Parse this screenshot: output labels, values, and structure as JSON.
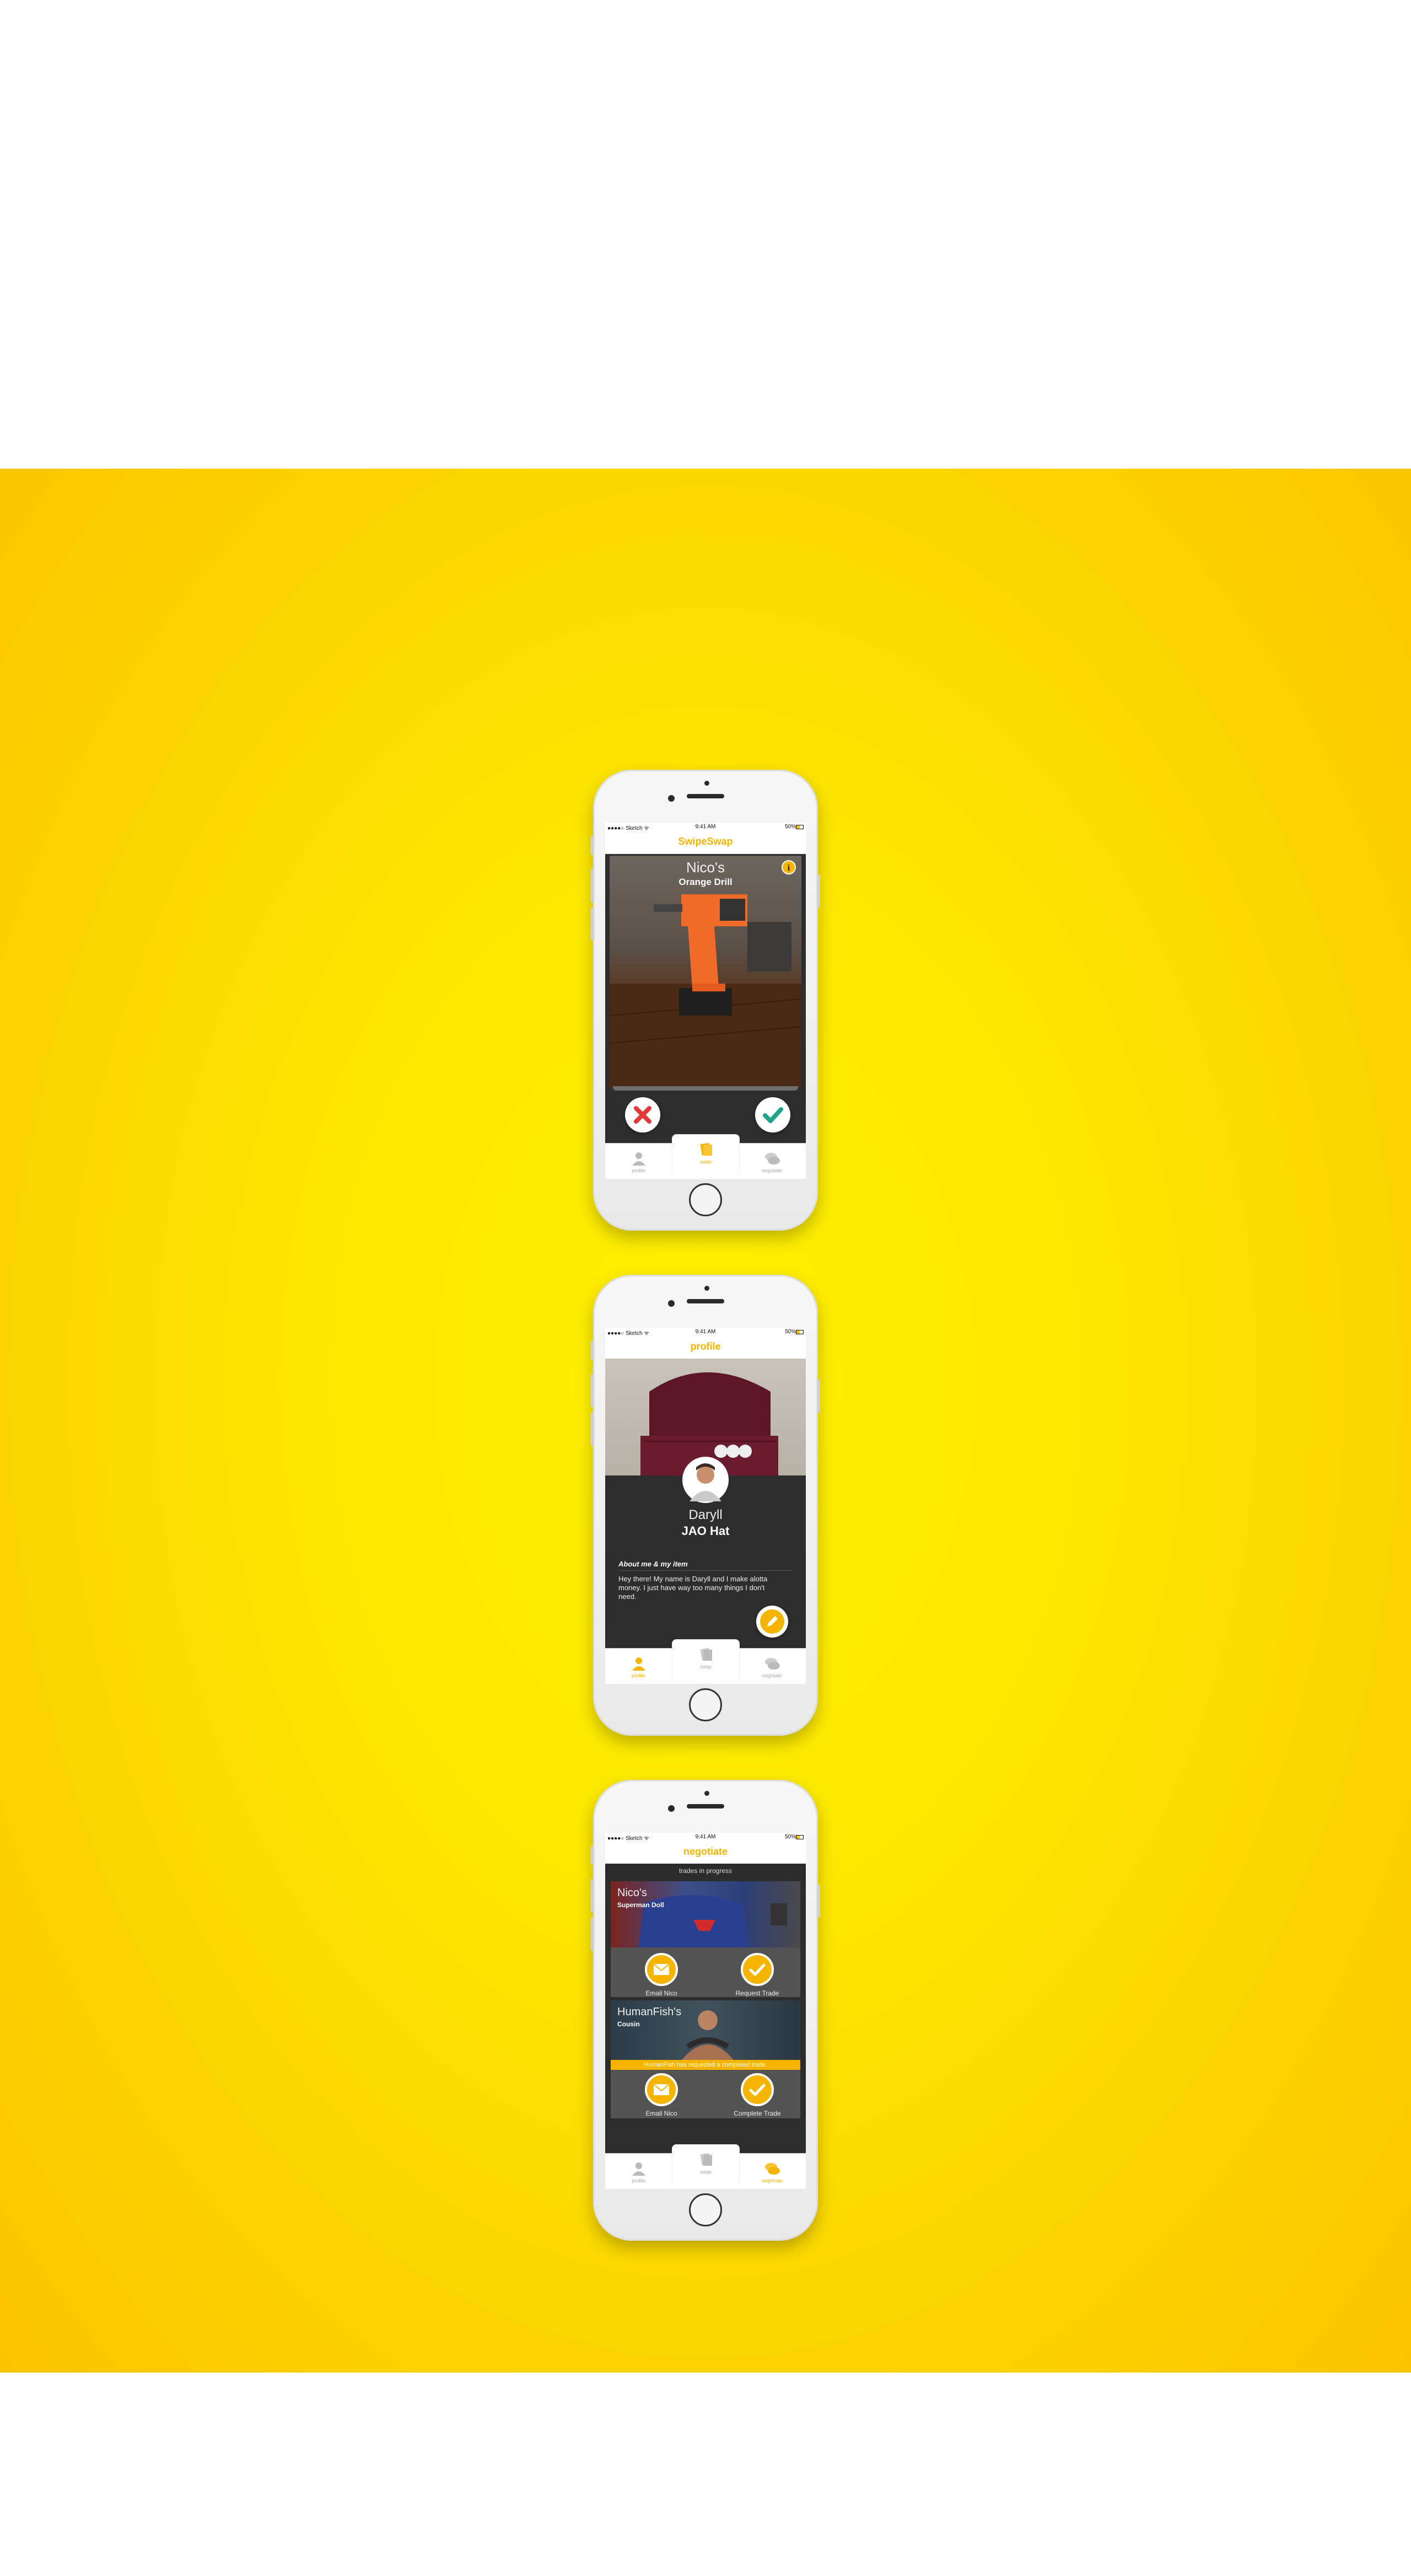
{
  "status_bar": {
    "carrier": "●●●●○ Sketch ᯤ",
    "time": "9:41 AM",
    "battery": "50%"
  },
  "tabs": {
    "profile": "profile",
    "swap": "swap",
    "negotiate": "negotiate"
  },
  "screen_swipe": {
    "title": "SwipeSwap",
    "owner": "Nico's",
    "item": "Orange Drill",
    "info_label": "i"
  },
  "screen_profile": {
    "title": "profile",
    "name": "Daryll",
    "item": "JAO Hat",
    "about_heading": "About me & my item",
    "about_text": "Hey there! My name is Daryll and I make alotta money. I just have way too many things I don't need."
  },
  "screen_negotiate": {
    "title": "negotiate",
    "subheading": "trades in progress",
    "trades": [
      {
        "owner": "Nico's",
        "item": "Superman Doll",
        "left_action": "Email Nico",
        "right_action": "Request Trade",
        "banner": ""
      },
      {
        "owner": "HumanFish's",
        "item": "Cousin",
        "left_action": "Email Nico",
        "right_action": "Complete Trade",
        "banner": "HumanFish has requested a completed trade."
      }
    ]
  },
  "colors": {
    "accent": "#f5b400",
    "dark": "#2d2d2d",
    "reject": "#e03a3a",
    "accept": "#1fa38a"
  }
}
